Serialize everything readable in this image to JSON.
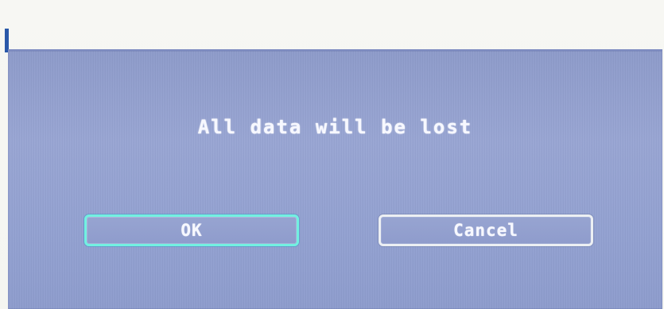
{
  "dialog": {
    "message": "All data will be lost",
    "buttons": {
      "ok_label": "OK",
      "cancel_label": "Cancel"
    }
  },
  "colors": {
    "background": "#f7f8f6",
    "dialog_background": "#93a1d0",
    "focus_border": "#72f0e1",
    "text": "#f7f8ff"
  }
}
